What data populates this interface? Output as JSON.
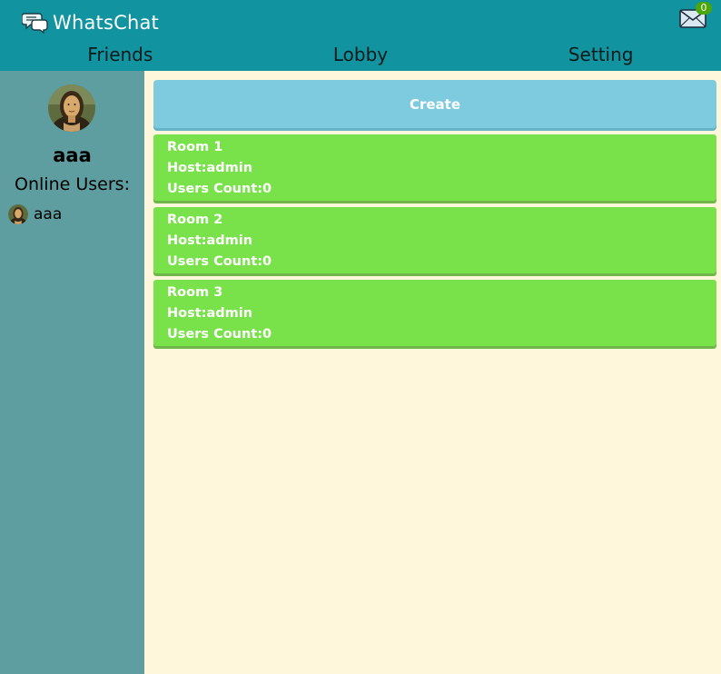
{
  "app": {
    "title": "WhatsChat"
  },
  "notifications": {
    "count": "0"
  },
  "nav": {
    "tabs": [
      "Friends",
      "Lobby",
      "Setting"
    ]
  },
  "sidebar": {
    "username": "aaa",
    "online_title": "Online Users:",
    "online_users": [
      "aaa"
    ]
  },
  "lobby": {
    "create_label": "Create",
    "rooms": [
      {
        "name": "Room 1",
        "host": "Host:admin",
        "users": "Users Count:0"
      },
      {
        "name": "Room 2",
        "host": "Host:admin",
        "users": "Users Count:0"
      },
      {
        "name": "Room 3",
        "host": "Host:admin",
        "users": "Users Count:0"
      }
    ]
  },
  "colors": {
    "header": "#1293a0",
    "sidebar": "#5f9ea0",
    "content": "#fff7dc",
    "create_button": "#7ecbe0",
    "room_card": "#79e149",
    "badge": "#4aa60a"
  },
  "icons": {
    "logo": "chat-bubbles-icon",
    "mail": "envelope-icon",
    "avatar": "portrait-avatar"
  }
}
